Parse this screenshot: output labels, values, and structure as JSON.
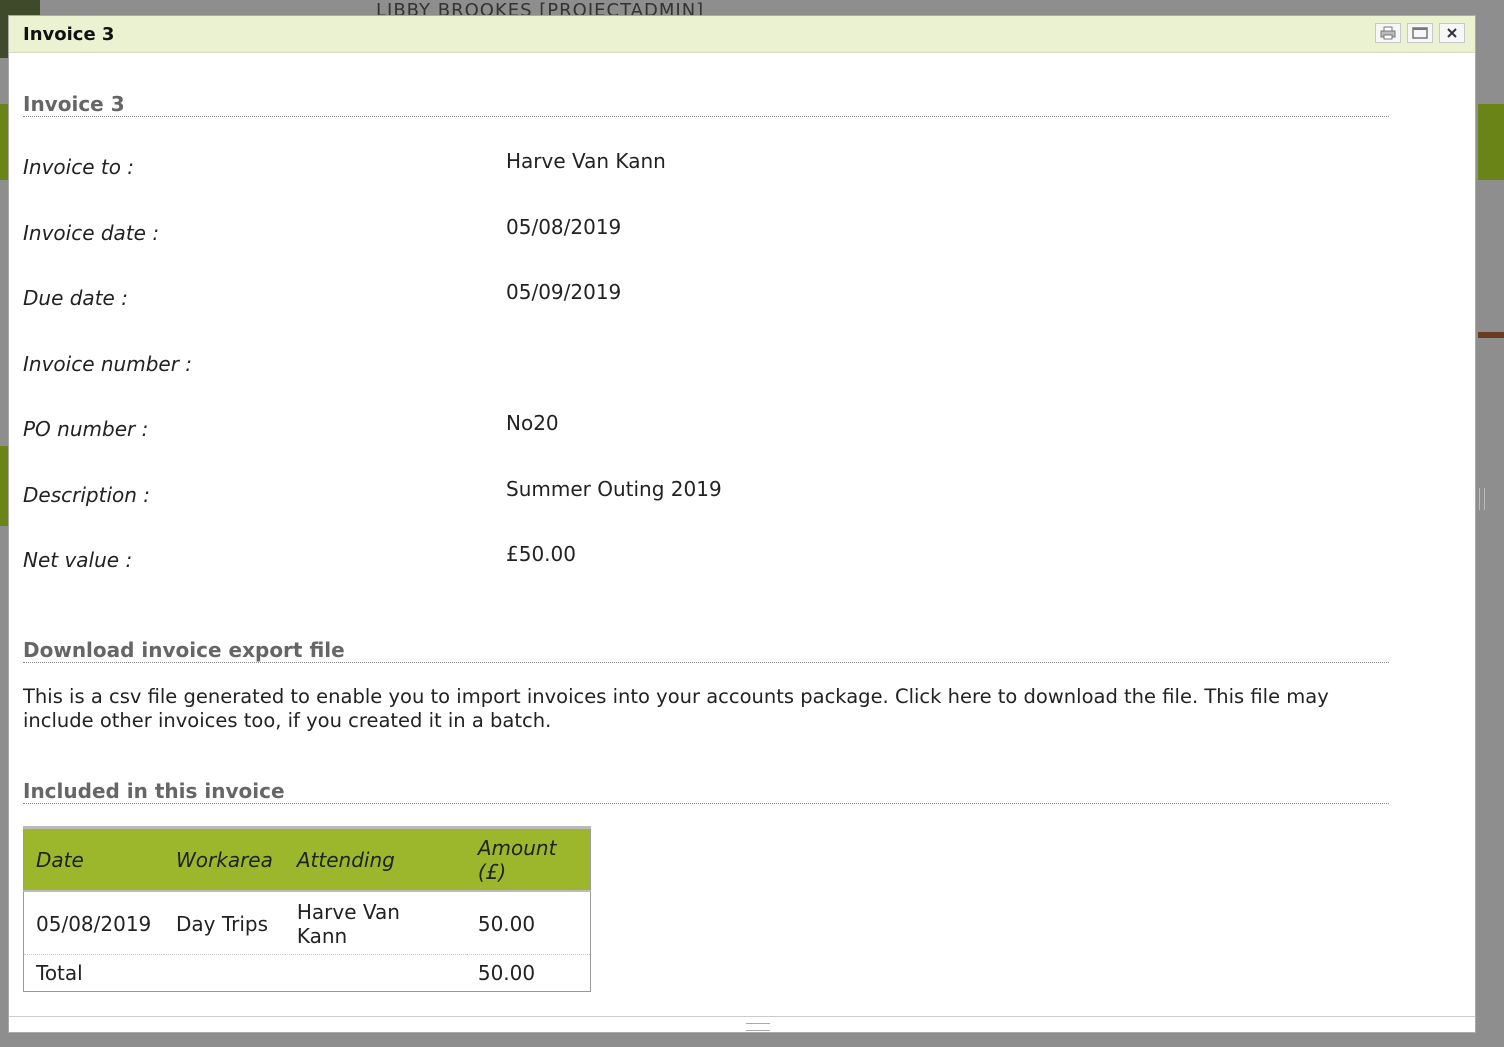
{
  "background": {
    "user_text": "LIBBY BROOKES [PROJECTADMIN]"
  },
  "dialog": {
    "title": "Invoice 3",
    "buttons": {
      "print_icon": "printer-icon",
      "maximize_icon": "maximize-icon",
      "close_icon": "close-icon"
    }
  },
  "invoice": {
    "heading": "Invoice 3",
    "fields": [
      {
        "label": "Invoice to :",
        "value": "Harve Van Kann"
      },
      {
        "label": "Invoice date :",
        "value": "05/08/2019"
      },
      {
        "label": "Due date :",
        "value": "05/09/2019"
      },
      {
        "label": "Invoice number :",
        "value": ""
      },
      {
        "label": "PO number :",
        "value": "No20"
      },
      {
        "label": "Description :",
        "value": "Summer Outing 2019"
      },
      {
        "label": "Net value :",
        "value": "£50.00"
      }
    ]
  },
  "download": {
    "heading": "Download invoice export file",
    "text_before": "This is a csv file generated to enable you to import invoices into your accounts package. Click ",
    "link": "here",
    "text_after": " to download the file. This file may include other invoices too, if you created it in a batch."
  },
  "included": {
    "heading": "Included in this invoice",
    "columns": [
      "Date",
      "Workarea",
      "Attending",
      "Amount (£)"
    ],
    "rows": [
      [
        "05/08/2019",
        "Day Trips",
        "Harve Van Kann",
        "50.00"
      ]
    ],
    "total_label": "Total",
    "total_value": "50.00"
  },
  "colors": {
    "header_green": "#9cb72c",
    "titlebar": "#eaf2d2"
  }
}
